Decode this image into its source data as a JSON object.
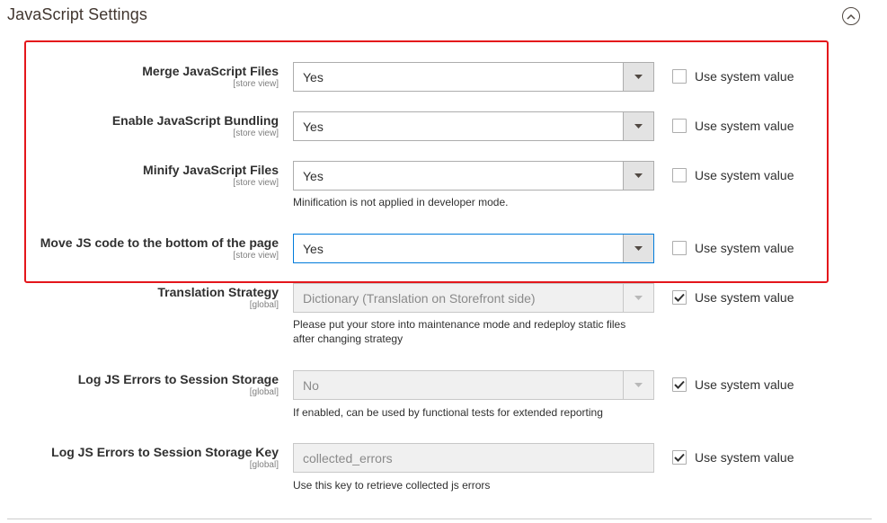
{
  "section": {
    "title": "JavaScript Settings",
    "collapse_icon": "chevron-up-circle-icon"
  },
  "use_system_label": "Use system value",
  "fields": [
    {
      "id": "merge_js",
      "label": "Merge JavaScript Files",
      "scope": "[store view]",
      "type": "select",
      "value": "Yes",
      "disabled": false,
      "use_system": false,
      "note": ""
    },
    {
      "id": "enable_bundling",
      "label": "Enable JavaScript Bundling",
      "scope": "[store view]",
      "type": "select",
      "value": "Yes",
      "disabled": false,
      "use_system": false,
      "note": ""
    },
    {
      "id": "minify_js",
      "label": "Minify JavaScript Files",
      "scope": "[store view]",
      "type": "select",
      "value": "Yes",
      "disabled": false,
      "use_system": false,
      "note": "Minification is not applied in developer mode."
    },
    {
      "id": "move_js_bottom",
      "label": "Move JS code to the bottom of the page",
      "scope": "[store view]",
      "type": "select",
      "value": "Yes",
      "disabled": false,
      "focused": true,
      "use_system": false,
      "note": ""
    },
    {
      "id": "translation_strategy",
      "label": "Translation Strategy",
      "scope": "[global]",
      "type": "select",
      "value": "Dictionary (Translation on Storefront side)",
      "disabled": true,
      "use_system": true,
      "note_line1": "Please put your store into maintenance mode and redeploy static files",
      "note_line2": "after changing strategy"
    },
    {
      "id": "log_js_errors",
      "label": "Log JS Errors to Session Storage",
      "scope": "[global]",
      "type": "select",
      "value": "No",
      "disabled": true,
      "use_system": true,
      "note": "If enabled, can be used by functional tests for extended reporting"
    },
    {
      "id": "log_js_errors_key",
      "label": "Log JS Errors to Session Storage Key",
      "scope": "[global]",
      "type": "text",
      "value": "collected_errors",
      "disabled": true,
      "use_system": true,
      "note": "Use this key to retrieve collected js errors"
    }
  ],
  "colors": {
    "highlight": "#e4161b",
    "focus": "#007bdb"
  }
}
